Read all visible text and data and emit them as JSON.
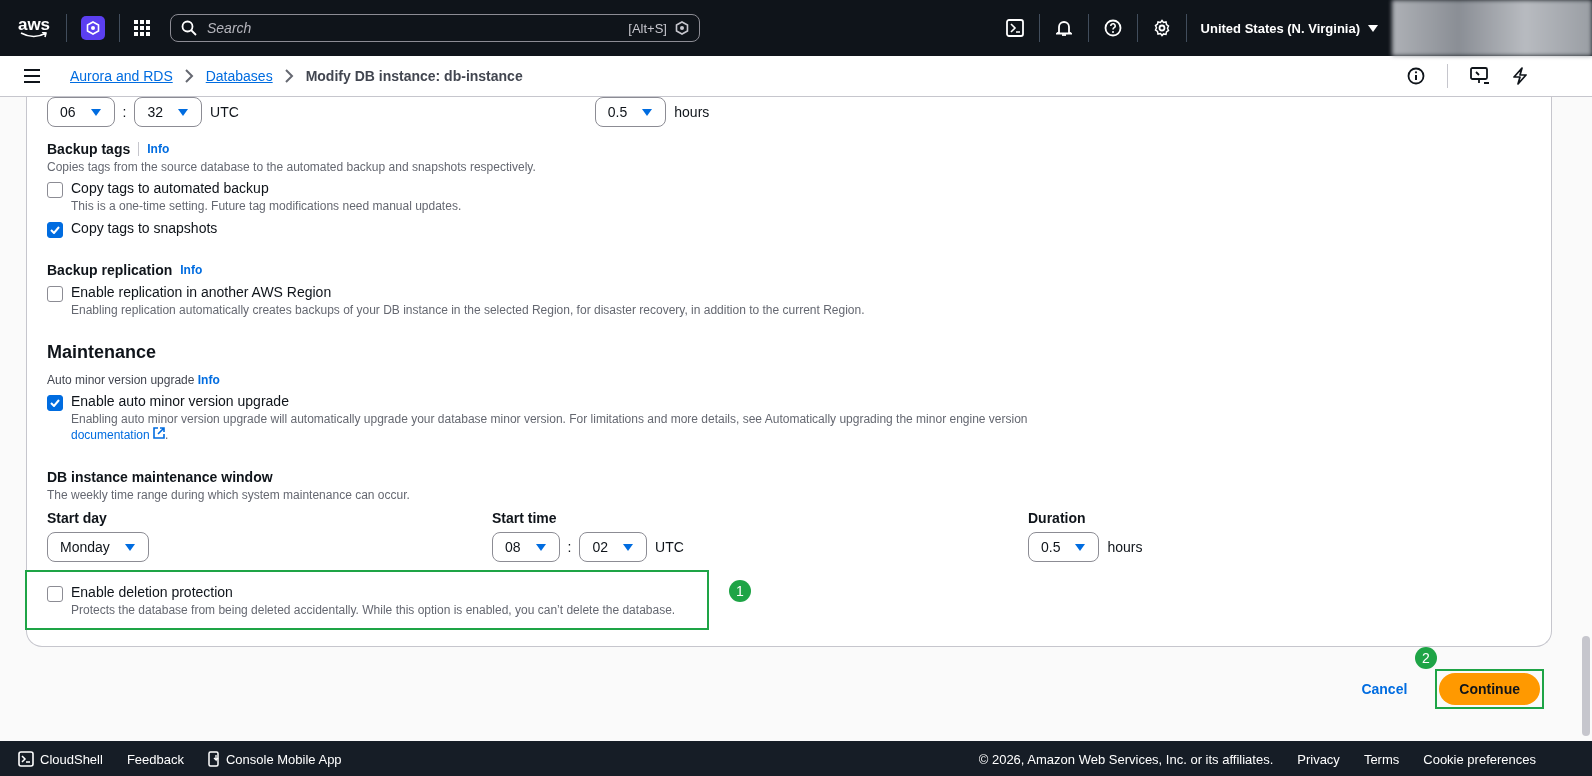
{
  "top_nav": {
    "logo": "aws",
    "search": {
      "placeholder": "Search",
      "shortcut": "[Alt+S]"
    },
    "region": "United States (N. Virginia)"
  },
  "breadcrumbs": [
    {
      "label": "Aurora and RDS",
      "link": true
    },
    {
      "label": "Databases",
      "link": true
    },
    {
      "label": "Modify DB instance: db-instance",
      "link": false
    }
  ],
  "backup_window_row": {
    "hour": "06",
    "separator": ":",
    "minute": "32",
    "timezone": "UTC",
    "duration": "0.5",
    "duration_unit": "hours"
  },
  "backup_tags": {
    "title": "Backup tags",
    "info": "Info",
    "description": "Copies tags from the source database to the automated backup and snapshots respectively.",
    "options": [
      {
        "label": "Copy tags to automated backup",
        "hint": "This is a one-time setting. Future tag modifications need manual updates.",
        "checked": false
      },
      {
        "label": "Copy tags to snapshots",
        "checked": true
      }
    ]
  },
  "backup_replication": {
    "title": "Backup replication",
    "info": "Info",
    "options": [
      {
        "label": "Enable replication in another AWS Region",
        "hint": "Enabling replication automatically creates backups of your DB instance in the selected Region, for disaster recovery, in addition to the current Region.",
        "checked": false
      }
    ]
  },
  "maintenance": {
    "heading": "Maintenance",
    "label": "Auto minor version upgrade",
    "info": "Info",
    "option": {
      "label": "Enable auto minor version upgrade",
      "hint": "Enabling auto minor version upgrade will automatically upgrade your database minor version. For limitations and more details, see Automatically upgrading the minor engine version",
      "link": "documentation",
      "hint_end": ".",
      "checked": true
    }
  },
  "maintenance_window": {
    "title": "DB instance maintenance window",
    "description": "The weekly time range during which system maintenance can occur.",
    "start_day": {
      "label": "Start day",
      "value": "Monday"
    },
    "start_time": {
      "label": "Start time",
      "hour": "08",
      "separator": ":",
      "minute": "02",
      "timezone": "UTC"
    },
    "duration": {
      "label": "Duration",
      "value": "0.5",
      "unit": "hours"
    }
  },
  "deletion_protection": {
    "label": "Enable deletion protection",
    "hint": "Protects the database from being deleted accidentally. While this option is enabled, you can’t delete the database.",
    "checked": false,
    "highlighted": true,
    "step": "1"
  },
  "actions": {
    "cancel": "Cancel",
    "continue": "Continue",
    "highlighted": true,
    "step": "2"
  },
  "footer": {
    "cloudshell": "CloudShell",
    "feedback": "Feedback",
    "mobile_app": "Console Mobile App",
    "copyright": "© 2026, Amazon Web Services, Inc. or its affiliates.",
    "links": [
      "Privacy",
      "Terms",
      "Cookie preferences"
    ]
  }
}
